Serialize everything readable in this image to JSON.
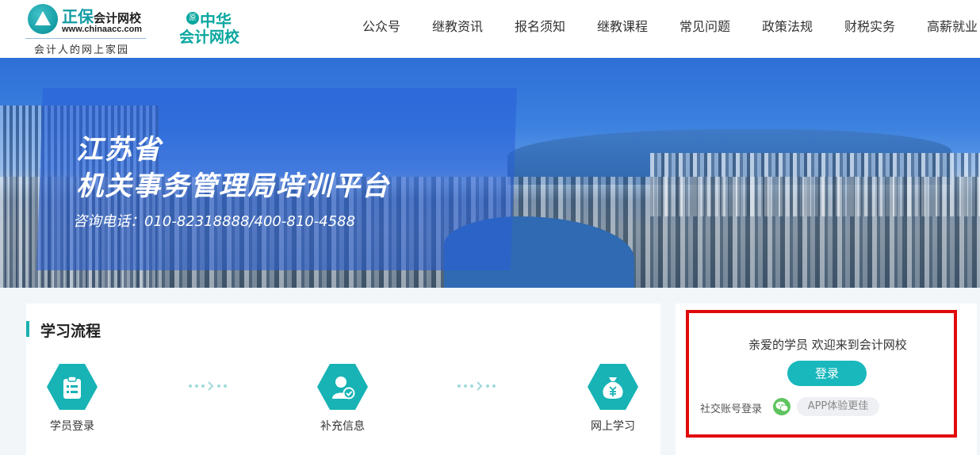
{
  "header": {
    "logo1": {
      "brand": "正保",
      "brand_sub": "会计网校",
      "url": "www.chinaacc.com",
      "slogan": "会计人的网上家园"
    },
    "logo2": {
      "badge": "原",
      "top": "中华",
      "bottom": "会计网校"
    },
    "nav": [
      {
        "label": "公众号"
      },
      {
        "label": "继教资讯"
      },
      {
        "label": "报名须知"
      },
      {
        "label": "继教课程"
      },
      {
        "label": "常见问题"
      },
      {
        "label": "政策法规"
      },
      {
        "label": "财税实务"
      },
      {
        "label": "高薪就业"
      }
    ]
  },
  "banner": {
    "title_line1": "江苏省",
    "title_line2": "机关事务管理局培训平台",
    "phone": "咨询电话：010-82318888/400-810-4588"
  },
  "process": {
    "title": "学习流程",
    "steps": [
      {
        "label": "学员登录",
        "icon": "clipboard-icon"
      },
      {
        "label": "补充信息",
        "icon": "user-check-icon"
      },
      {
        "label": "网上学习",
        "icon": "money-bag-icon"
      }
    ]
  },
  "login": {
    "greeting": "亲爱的学员 欢迎来到会计网校",
    "button": "登录",
    "social_label": "社交账号登录",
    "app_pill": "APP体验更佳"
  },
  "colors": {
    "accent": "#19b8bd",
    "frame": "#e10b0b"
  }
}
